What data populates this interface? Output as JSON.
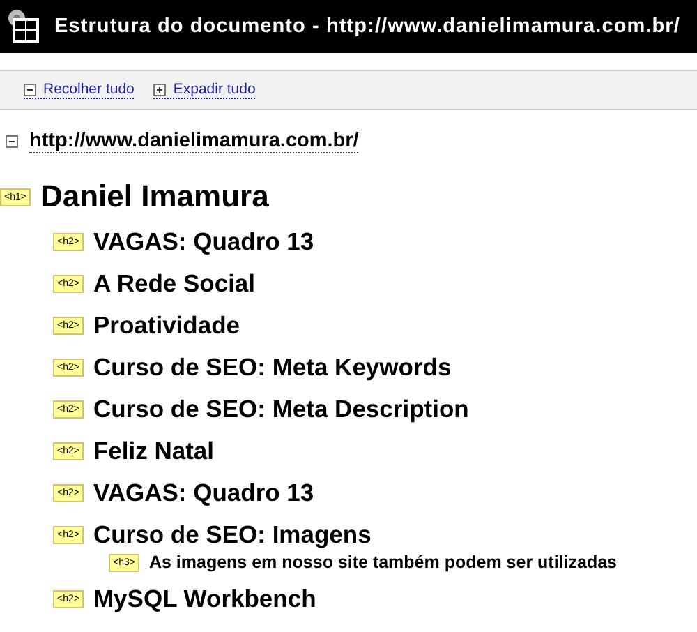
{
  "window": {
    "title": "Estrutura do documento - http://www.danielimamura.com.br/"
  },
  "toolbar": [
    {
      "kind": "collapse",
      "label": "Recolher tudo"
    },
    {
      "kind": "expand",
      "label": "Expadir tudo"
    }
  ],
  "outline": {
    "text": "http://www.danielimamura.com.br/",
    "expanded": true,
    "children": [
      {
        "tag": "<h1>",
        "text": "Daniel Imamura",
        "children": [
          {
            "tag": "<h2>",
            "text": "VAGAS: Quadro 13"
          },
          {
            "tag": "<h2>",
            "text": "A Rede Social"
          },
          {
            "tag": "<h2>",
            "text": "Proatividade"
          },
          {
            "tag": "<h2>",
            "text": "Curso de SEO: Meta Keywords"
          },
          {
            "tag": "<h2>",
            "text": "Curso de SEO: Meta Description"
          },
          {
            "tag": "<h2>",
            "text": "Feliz Natal"
          },
          {
            "tag": "<h2>",
            "text": "VAGAS: Quadro 13"
          },
          {
            "tag": "<h2>",
            "text": "Curso de SEO: Imagens",
            "children": [
              {
                "tag": "<h3>",
                "text": "As imagens em nosso site também podem ser utilizadas"
              }
            ]
          },
          {
            "tag": "<h2>",
            "text": "MySQL Workbench"
          }
        ]
      }
    ]
  }
}
